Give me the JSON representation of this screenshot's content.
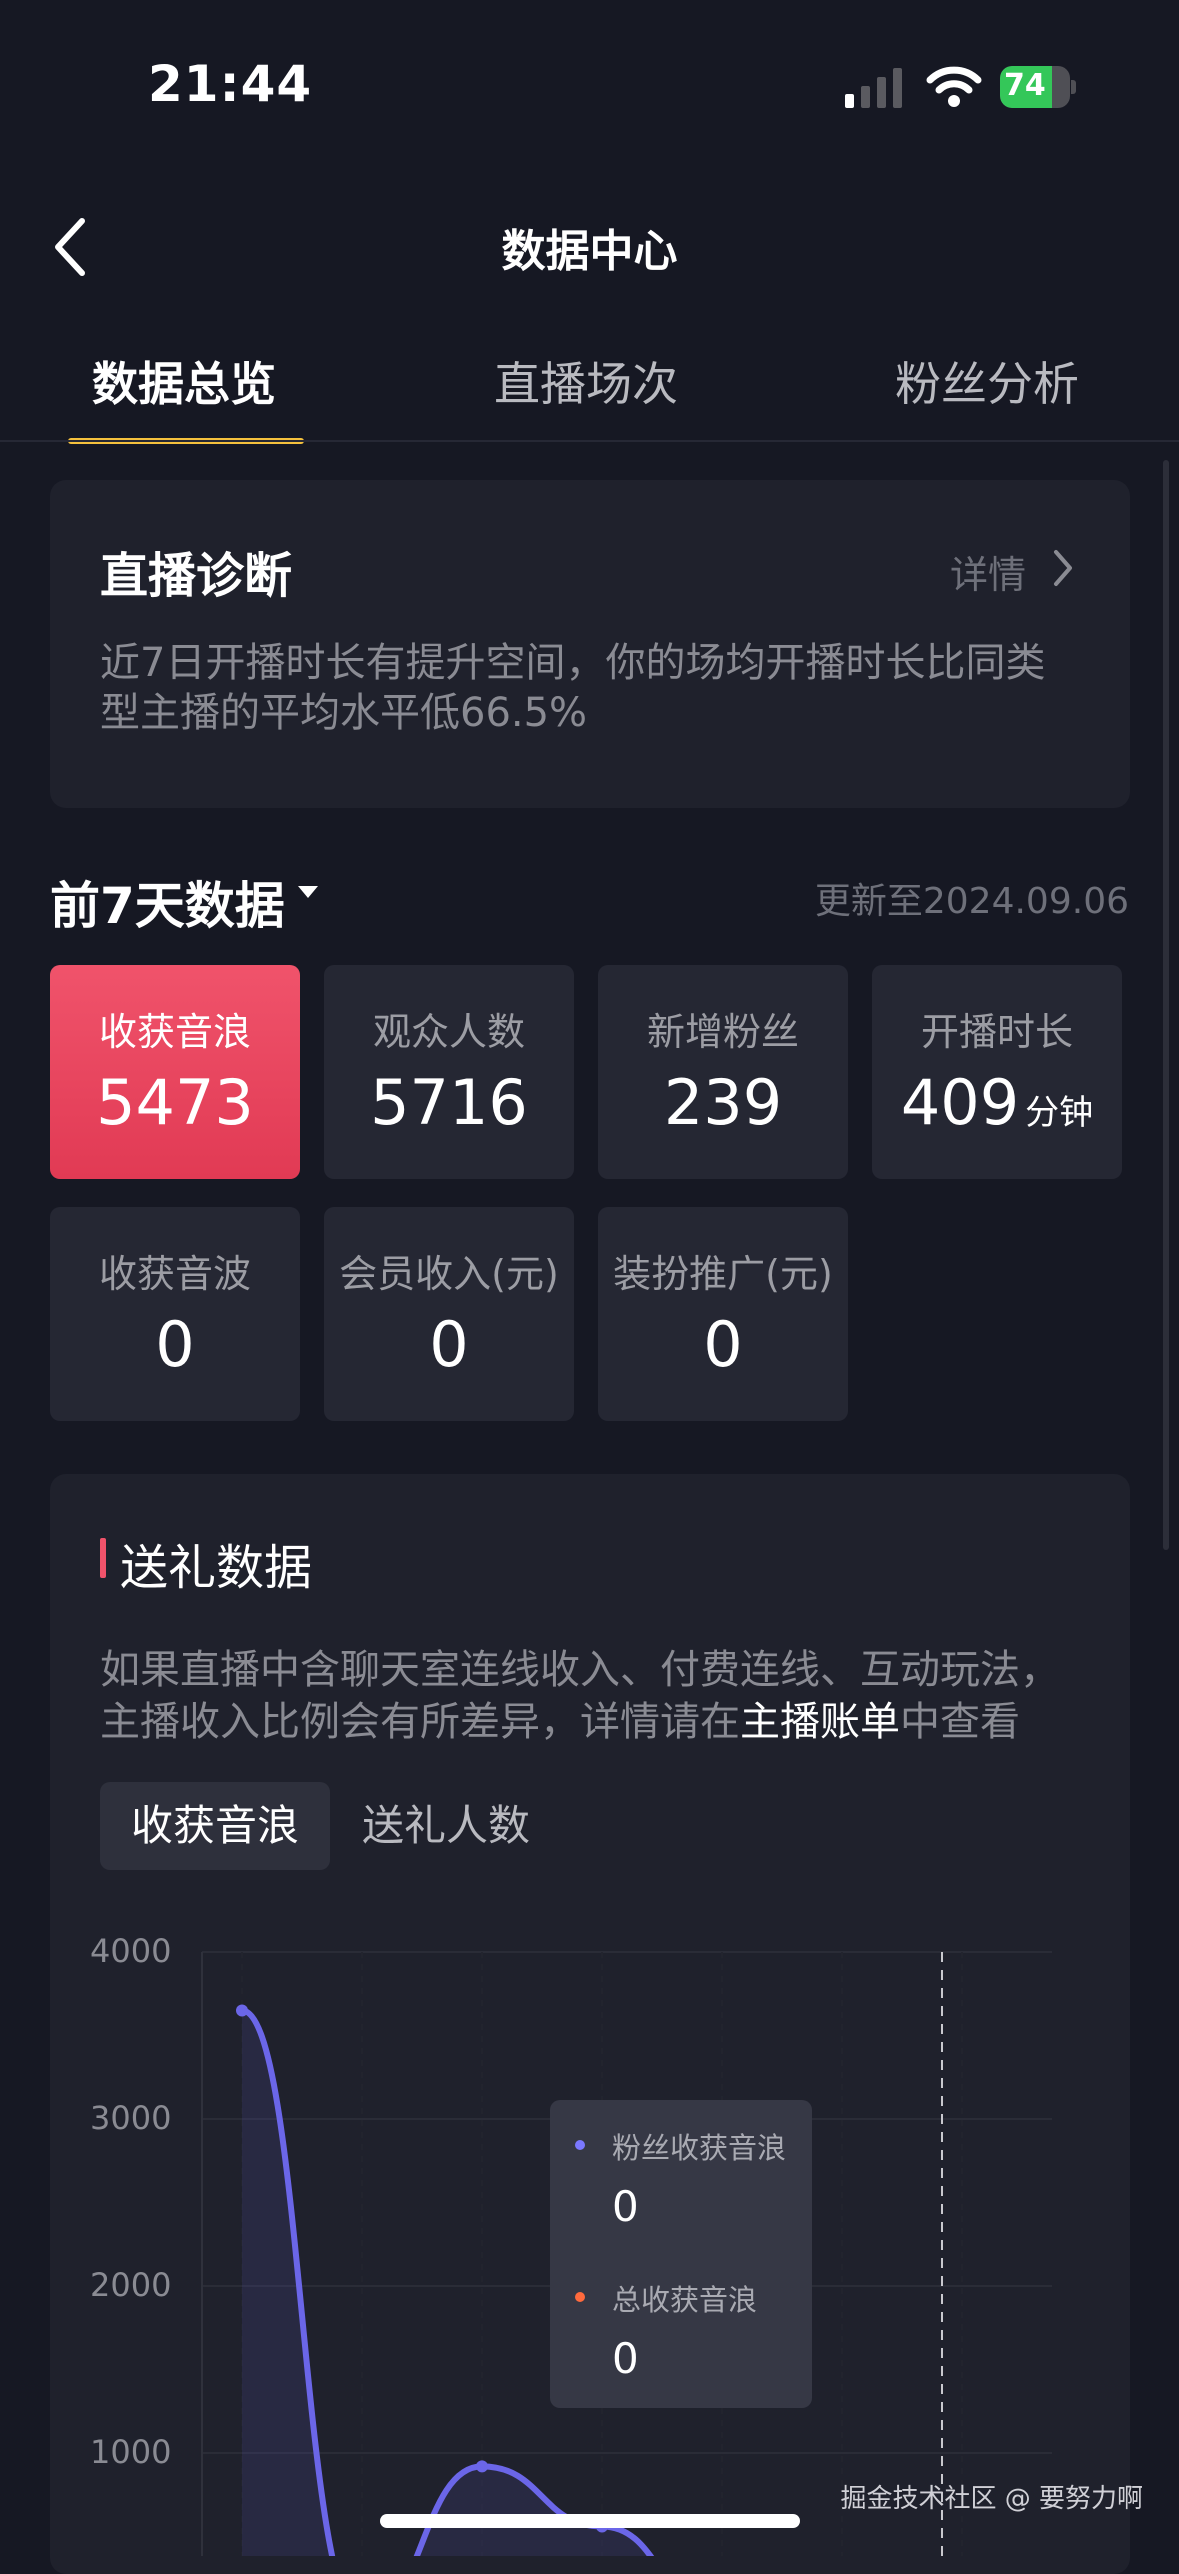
{
  "status": {
    "time": "21:44",
    "battery": "74"
  },
  "header": {
    "title": "数据中心"
  },
  "tabs": [
    {
      "label": "数据总览"
    },
    {
      "label": "直播场次"
    },
    {
      "label": "粉丝分析"
    }
  ],
  "diagnosis": {
    "title": "直播诊断",
    "detail": "详情",
    "text": "近7日开播时长有提升空间，你的场均开播时长比同类型主播的平均水平低66.5%"
  },
  "period": {
    "label": "前7天数据",
    "updated": "更新至2024.09.06"
  },
  "stats": [
    {
      "label": "收获音浪",
      "value": "5473",
      "unit": ""
    },
    {
      "label": "观众人数",
      "value": "5716",
      "unit": ""
    },
    {
      "label": "新增粉丝",
      "value": "239",
      "unit": ""
    },
    {
      "label": "开播时长",
      "value": "409",
      "unit": "分钟"
    },
    {
      "label": "收获音波",
      "value": "0",
      "unit": ""
    },
    {
      "label": "会员收入(元)",
      "value": "0",
      "unit": ""
    },
    {
      "label": "装扮推广(元)",
      "value": "0",
      "unit": ""
    }
  ],
  "gift": {
    "title": "送礼数据",
    "text_before": "如果直播中含聊天室连线收入、付费连线、互动玩法，主播收入比例会有所差异，详情请在",
    "link": "主播账单",
    "text_after": "中查看",
    "segments": [
      "收获音浪",
      "送礼人数"
    ]
  },
  "tooltip": {
    "items": [
      {
        "label": "粉丝收获音浪",
        "value": "0",
        "color": "#7b78ff"
      },
      {
        "label": "总收获音浪",
        "value": "0",
        "color": "#ff6a3d"
      }
    ]
  },
  "chart_data": {
    "type": "line",
    "ylim": [
      0,
      4000
    ],
    "yticks": [
      "4000",
      "3000",
      "2000",
      "1000"
    ],
    "series": [
      {
        "values": [
          3650,
          0,
          920,
          560,
          0,
          0,
          0
        ]
      }
    ],
    "colors": {
      "line": "#6b66e8"
    }
  },
  "watermark": "掘金技术社区 @ 要努力啊"
}
